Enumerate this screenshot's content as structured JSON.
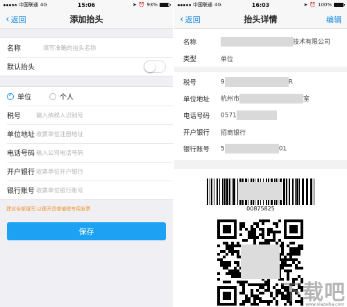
{
  "left": {
    "status": {
      "carrier": "中国联通",
      "network": "4G",
      "time": "15:06",
      "battery": "93%",
      "battery_level": 0.93
    },
    "nav": {
      "back": "返回",
      "title": "添加抬头"
    },
    "name_row": {
      "label": "名称",
      "placeholder": "填写准确的抬头名称"
    },
    "default_row": {
      "label": "默认抬头"
    },
    "radio": {
      "unit": "单位",
      "personal": "个人"
    },
    "fields": [
      {
        "label": "税号",
        "placeholder": "输入纳税人识别号"
      },
      {
        "label": "单位地址",
        "placeholder": "收票单位注册地址"
      },
      {
        "label": "电话号码",
        "placeholder": "输入公司电话号码"
      },
      {
        "label": "开户银行",
        "placeholder": "收票单位开户银行"
      },
      {
        "label": "银行账号",
        "placeholder": "收票单位银行账号"
      }
    ],
    "hint": "建议全部填写,以便开具增值税专用发票",
    "save": "保存"
  },
  "right": {
    "status": {
      "carrier": "中国联通",
      "network": "4G",
      "time": "16:03",
      "battery": "100%",
      "battery_level": 1.0
    },
    "nav": {
      "back": "返回",
      "title": "抬头详情",
      "edit": "编辑"
    },
    "rows": [
      {
        "label": "名称",
        "value_prefix": "",
        "value_suffix": "技术有限公司"
      },
      {
        "label": "类型",
        "value_prefix": "单位",
        "value_suffix": ""
      },
      {
        "label": "税号",
        "value_prefix": "9",
        "value_suffix": "R"
      },
      {
        "label": "单位地址",
        "value_prefix": "杭州市",
        "value_suffix": "室"
      },
      {
        "label": "电话号码",
        "value_prefix": "0571",
        "value_suffix": ""
      },
      {
        "label": "开户银行",
        "value_prefix": "招商银行",
        "value_suffix": ""
      },
      {
        "label": "银行账号",
        "value_prefix": "5",
        "value_suffix": "01"
      }
    ],
    "barcode_number": "00875825",
    "watermark": "下载吧",
    "watermark_url": "www.xiazaiba.com"
  },
  "colors": {
    "accent": "#1a8ae0",
    "button": "#1da1f2",
    "hint": "#f0901f"
  },
  "icons": [
    "back-chevron-icon",
    "alarm-icon",
    "location-icon",
    "radio-checked-icon",
    "radio-unchecked-icon",
    "barcode",
    "qr-code"
  ]
}
